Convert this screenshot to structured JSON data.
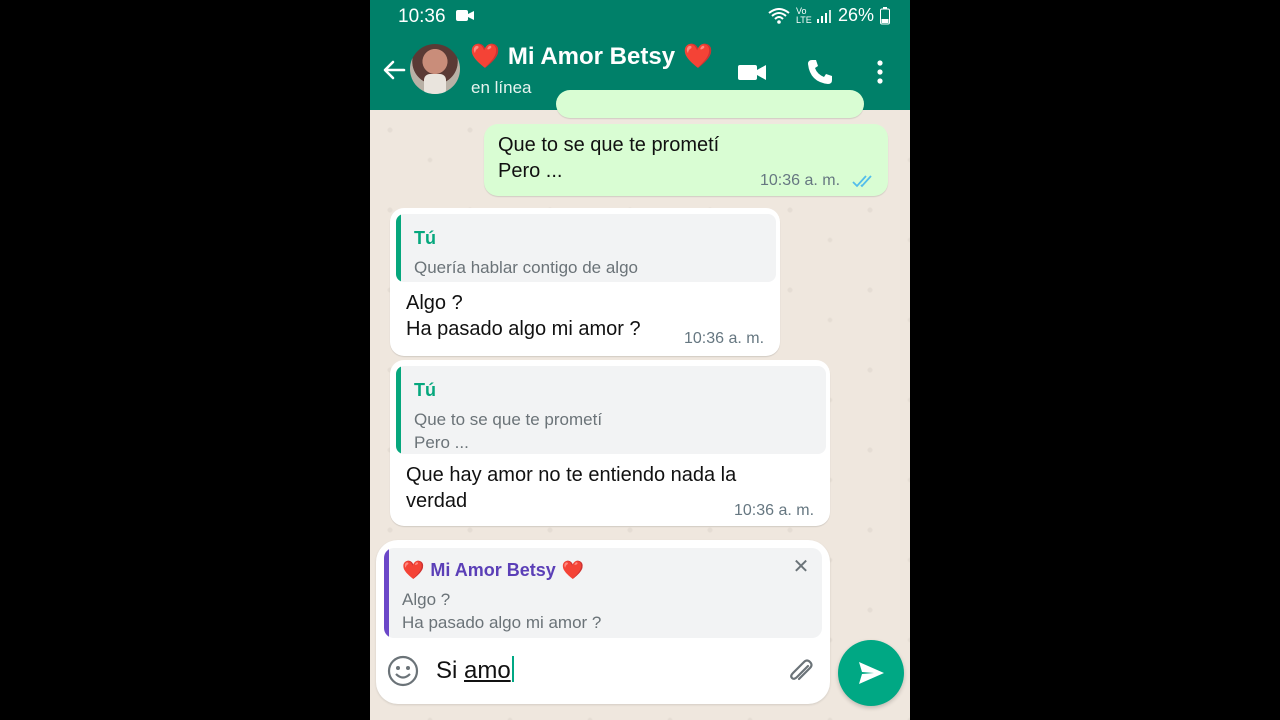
{
  "status_bar": {
    "time": "10:36",
    "network": "Vo LTE",
    "battery": "26%"
  },
  "header": {
    "contact_name": "Mi Amor Betsy",
    "heart_left": "❤️",
    "heart_right": "❤️",
    "presence": "en línea"
  },
  "messages": [
    {
      "direction": "outgoing",
      "lines": [
        "Que to se que te prometí",
        "Pero ..."
      ],
      "time": "10:36 a. m.",
      "status": "read"
    },
    {
      "direction": "incoming",
      "quote": {
        "author": "Tú",
        "text": [
          "Quería hablar contigo de algo"
        ]
      },
      "lines": [
        "Algo ?",
        "Ha pasado algo mi amor ?"
      ],
      "time": "10:36 a. m."
    },
    {
      "direction": "incoming",
      "quote": {
        "author": "Tú",
        "text": [
          "Que to se que te prometí",
          "Pero ..."
        ]
      },
      "lines": [
        "Que hay amor no te entiendo nada la",
        "verdad"
      ],
      "time": "10:36 a. m."
    }
  ],
  "reply_preview": {
    "author": "Mi Amor Betsy",
    "heart_left": "❤️",
    "heart_right": "❤️",
    "lines": [
      "Algo ?",
      "Ha pasado algo mi amor ?"
    ]
  },
  "composer": {
    "text_prefix": "Si ",
    "text_underlined": "amo"
  },
  "colors": {
    "header": "#008069",
    "accent": "#00a884",
    "outgoing": "#d9fdd3",
    "incoming": "#ffffff",
    "reply_bar": "#6b47c8",
    "tick": "#53bdeb"
  },
  "icons": [
    "back-arrow-icon",
    "video-call-icon",
    "phone-icon",
    "more-vert-icon",
    "emoji-icon",
    "attach-icon",
    "send-icon",
    "close-icon",
    "read-ticks-icon"
  ]
}
